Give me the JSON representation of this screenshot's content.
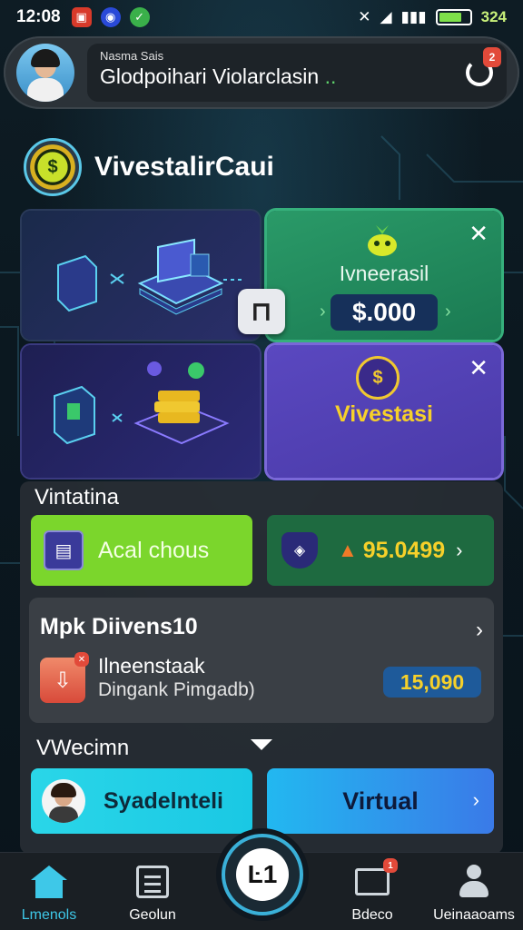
{
  "status_bar": {
    "time": "12:08",
    "battery_text": "324",
    "battery_level": 0.75,
    "icons": [
      "mute-icon",
      "wifi-icon",
      "signal-icon",
      "battery-icon"
    ]
  },
  "header": {
    "small_text": "Nasma Sais",
    "main_text": "Glodpoihari Violarclasin",
    "dots": "..",
    "refresh_badge": "2"
  },
  "section": {
    "title": "VivestalirCaui"
  },
  "cards": {
    "promo_green": {
      "title": "Ivneerasil",
      "amount": "$.000"
    },
    "promo_purple": {
      "title": "Vivestasi"
    }
  },
  "panel": {
    "label_top": "Vintatina",
    "green_button": "Acal chous",
    "value_button": "95.0499",
    "invest": {
      "title": "Mpk Diivens10",
      "name": "Ilneenstaak",
      "subtitle": "Dingank Pimgadb)",
      "amount": "15,090"
    },
    "label_bottom": "VWecimn",
    "cyan_button": "Syadelnteli",
    "blue_button": "Virtual"
  },
  "bottom_nav": {
    "items": [
      {
        "label": "Lmenols"
      },
      {
        "label": "Geolun"
      },
      {
        "label": "Bdeco"
      },
      {
        "label": "Ueinaaoams"
      }
    ],
    "fab_label": "Ŀ1",
    "mail_badge": "1"
  },
  "colors": {
    "accent_cyan": "#3ec8e8",
    "green_card": "#2a9a68",
    "purple_card": "#5a48c0",
    "gold_text": "#f6d02a",
    "lime_button": "#7bd62c"
  }
}
